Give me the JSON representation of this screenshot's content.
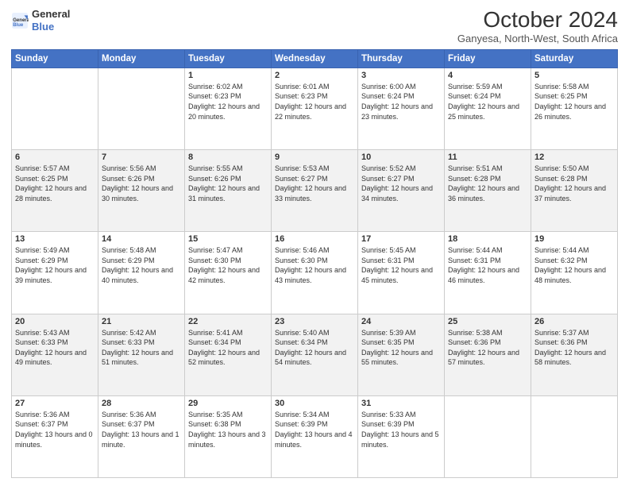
{
  "app": {
    "name_general": "General",
    "name_blue": "Blue"
  },
  "header": {
    "title": "October 2024",
    "subtitle": "Ganyesa, North-West, South Africa"
  },
  "days_of_week": [
    "Sunday",
    "Monday",
    "Tuesday",
    "Wednesday",
    "Thursday",
    "Friday",
    "Saturday"
  ],
  "weeks": [
    [
      {
        "day": "",
        "info": ""
      },
      {
        "day": "",
        "info": ""
      },
      {
        "day": "1",
        "info": "Sunrise: 6:02 AM\nSunset: 6:23 PM\nDaylight: 12 hours and 20 minutes."
      },
      {
        "day": "2",
        "info": "Sunrise: 6:01 AM\nSunset: 6:23 PM\nDaylight: 12 hours and 22 minutes."
      },
      {
        "day": "3",
        "info": "Sunrise: 6:00 AM\nSunset: 6:24 PM\nDaylight: 12 hours and 23 minutes."
      },
      {
        "day": "4",
        "info": "Sunrise: 5:59 AM\nSunset: 6:24 PM\nDaylight: 12 hours and 25 minutes."
      },
      {
        "day": "5",
        "info": "Sunrise: 5:58 AM\nSunset: 6:25 PM\nDaylight: 12 hours and 26 minutes."
      }
    ],
    [
      {
        "day": "6",
        "info": "Sunrise: 5:57 AM\nSunset: 6:25 PM\nDaylight: 12 hours and 28 minutes."
      },
      {
        "day": "7",
        "info": "Sunrise: 5:56 AM\nSunset: 6:26 PM\nDaylight: 12 hours and 30 minutes."
      },
      {
        "day": "8",
        "info": "Sunrise: 5:55 AM\nSunset: 6:26 PM\nDaylight: 12 hours and 31 minutes."
      },
      {
        "day": "9",
        "info": "Sunrise: 5:53 AM\nSunset: 6:27 PM\nDaylight: 12 hours and 33 minutes."
      },
      {
        "day": "10",
        "info": "Sunrise: 5:52 AM\nSunset: 6:27 PM\nDaylight: 12 hours and 34 minutes."
      },
      {
        "day": "11",
        "info": "Sunrise: 5:51 AM\nSunset: 6:28 PM\nDaylight: 12 hours and 36 minutes."
      },
      {
        "day": "12",
        "info": "Sunrise: 5:50 AM\nSunset: 6:28 PM\nDaylight: 12 hours and 37 minutes."
      }
    ],
    [
      {
        "day": "13",
        "info": "Sunrise: 5:49 AM\nSunset: 6:29 PM\nDaylight: 12 hours and 39 minutes."
      },
      {
        "day": "14",
        "info": "Sunrise: 5:48 AM\nSunset: 6:29 PM\nDaylight: 12 hours and 40 minutes."
      },
      {
        "day": "15",
        "info": "Sunrise: 5:47 AM\nSunset: 6:30 PM\nDaylight: 12 hours and 42 minutes."
      },
      {
        "day": "16",
        "info": "Sunrise: 5:46 AM\nSunset: 6:30 PM\nDaylight: 12 hours and 43 minutes."
      },
      {
        "day": "17",
        "info": "Sunrise: 5:45 AM\nSunset: 6:31 PM\nDaylight: 12 hours and 45 minutes."
      },
      {
        "day": "18",
        "info": "Sunrise: 5:44 AM\nSunset: 6:31 PM\nDaylight: 12 hours and 46 minutes."
      },
      {
        "day": "19",
        "info": "Sunrise: 5:44 AM\nSunset: 6:32 PM\nDaylight: 12 hours and 48 minutes."
      }
    ],
    [
      {
        "day": "20",
        "info": "Sunrise: 5:43 AM\nSunset: 6:33 PM\nDaylight: 12 hours and 49 minutes."
      },
      {
        "day": "21",
        "info": "Sunrise: 5:42 AM\nSunset: 6:33 PM\nDaylight: 12 hours and 51 minutes."
      },
      {
        "day": "22",
        "info": "Sunrise: 5:41 AM\nSunset: 6:34 PM\nDaylight: 12 hours and 52 minutes."
      },
      {
        "day": "23",
        "info": "Sunrise: 5:40 AM\nSunset: 6:34 PM\nDaylight: 12 hours and 54 minutes."
      },
      {
        "day": "24",
        "info": "Sunrise: 5:39 AM\nSunset: 6:35 PM\nDaylight: 12 hours and 55 minutes."
      },
      {
        "day": "25",
        "info": "Sunrise: 5:38 AM\nSunset: 6:36 PM\nDaylight: 12 hours and 57 minutes."
      },
      {
        "day": "26",
        "info": "Sunrise: 5:37 AM\nSunset: 6:36 PM\nDaylight: 12 hours and 58 minutes."
      }
    ],
    [
      {
        "day": "27",
        "info": "Sunrise: 5:36 AM\nSunset: 6:37 PM\nDaylight: 13 hours and 0 minutes."
      },
      {
        "day": "28",
        "info": "Sunrise: 5:36 AM\nSunset: 6:37 PM\nDaylight: 13 hours and 1 minute."
      },
      {
        "day": "29",
        "info": "Sunrise: 5:35 AM\nSunset: 6:38 PM\nDaylight: 13 hours and 3 minutes."
      },
      {
        "day": "30",
        "info": "Sunrise: 5:34 AM\nSunset: 6:39 PM\nDaylight: 13 hours and 4 minutes."
      },
      {
        "day": "31",
        "info": "Sunrise: 5:33 AM\nSunset: 6:39 PM\nDaylight: 13 hours and 5 minutes."
      },
      {
        "day": "",
        "info": ""
      },
      {
        "day": "",
        "info": ""
      }
    ]
  ]
}
